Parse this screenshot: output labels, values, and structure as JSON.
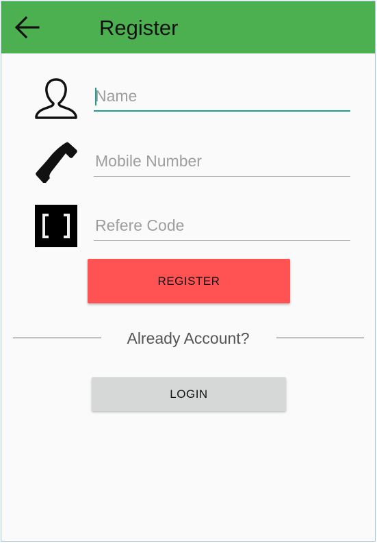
{
  "appbar": {
    "title": "Register",
    "back_icon": "arrow-left-icon",
    "color": "#4caf50"
  },
  "form": {
    "name": {
      "icon": "person-icon",
      "placeholder": "Name",
      "value": ""
    },
    "mobile": {
      "icon": "phone-icon",
      "placeholder": "Mobile Number",
      "value": ""
    },
    "refer_code": {
      "icon": "bracket-code-icon",
      "placeholder": "Refere Code",
      "value": ""
    },
    "register_label": "REGISTER"
  },
  "login_section": {
    "prompt": "Already Account?",
    "login_label": "LOGIN"
  },
  "colors": {
    "register_button": "#ff5252",
    "login_button": "#d6d7d7",
    "accent": "#1a9e8f"
  }
}
